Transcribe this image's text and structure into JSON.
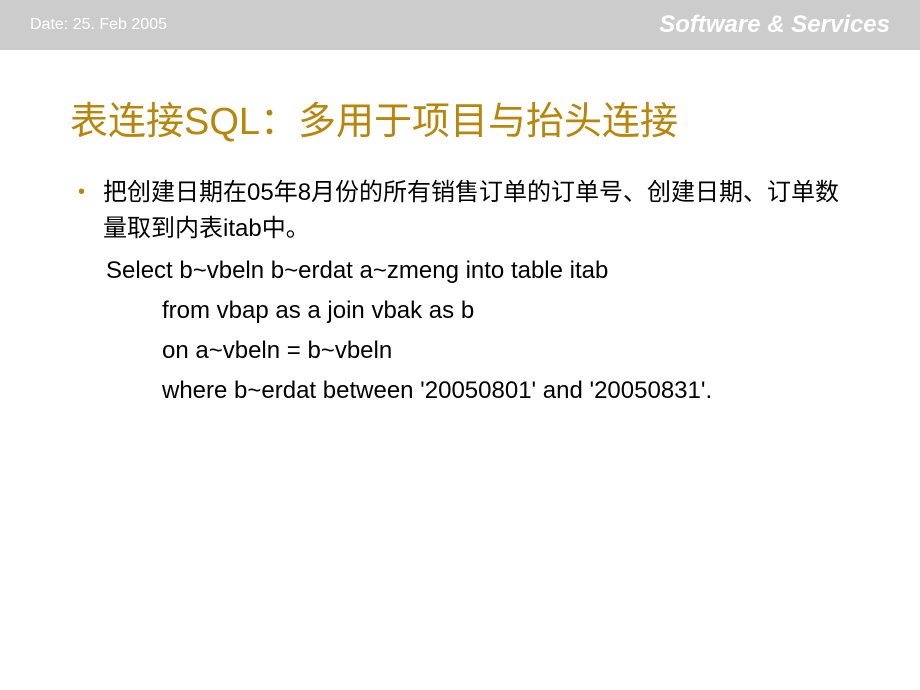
{
  "header": {
    "date": "Date: 25. Feb 2005",
    "brand": "Software & Services"
  },
  "slide": {
    "title": "表连接SQL：多用于项目与抬头连接",
    "bullet_text": "把创建日期在05年8月份的所有销售订单的订单号、创建日期、订单数量取到内表itab中。",
    "code_lines": {
      "line1": "Select b~vbeln b~erdat a~zmeng into table itab",
      "line2": "from vbap as a join vbak as b",
      "line3": "on a~vbeln = b~vbeln",
      "line4": "where b~erdat between '20050801' and '20050831'."
    }
  }
}
